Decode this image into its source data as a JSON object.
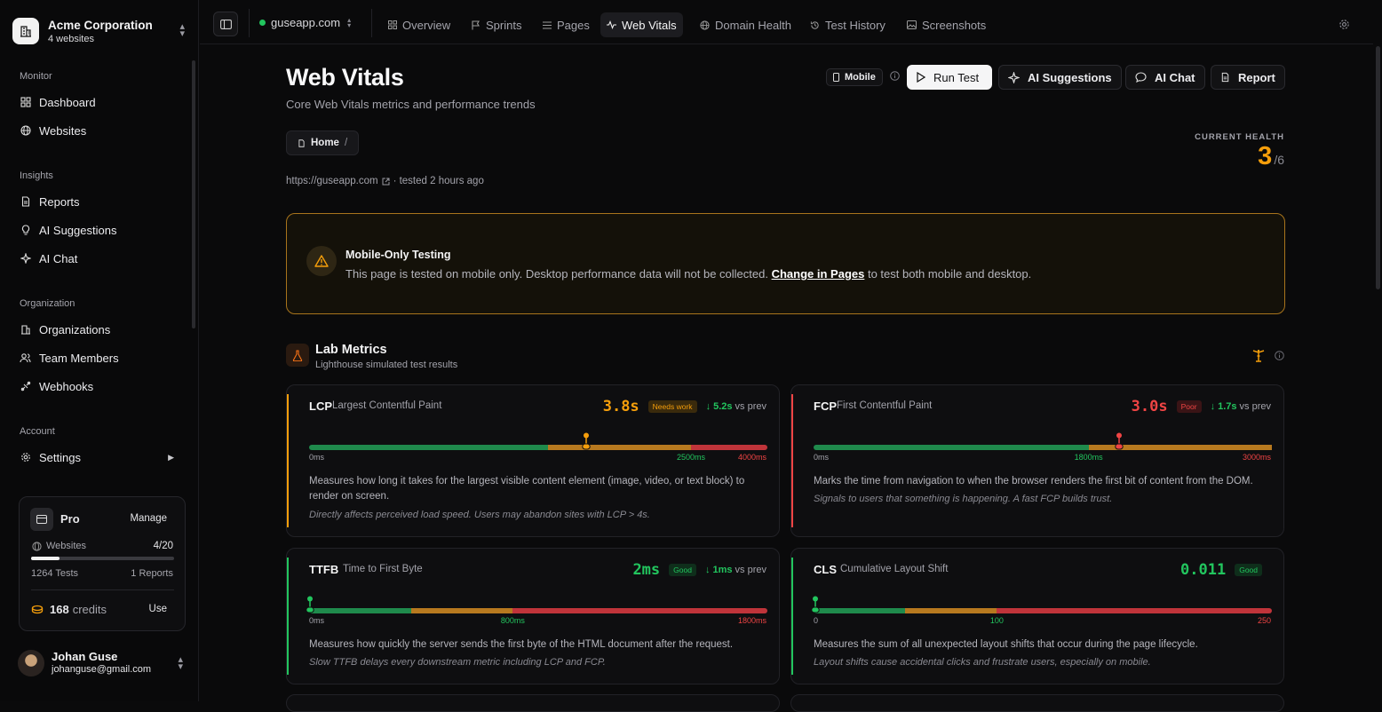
{
  "org": {
    "name": "Acme Corporation",
    "sub": "4 websites"
  },
  "sidebar": {
    "sections": [
      {
        "label": "Monitor",
        "items": [
          {
            "label": "Dashboard",
            "icon": "dashboard-icon"
          },
          {
            "label": "Websites",
            "icon": "globe-icon"
          }
        ]
      },
      {
        "label": "Insights",
        "items": [
          {
            "label": "Reports",
            "icon": "file-icon"
          },
          {
            "label": "AI Suggestions",
            "icon": "lightbulb-icon"
          },
          {
            "label": "AI Chat",
            "icon": "sparkle-icon"
          }
        ]
      },
      {
        "label": "Organization",
        "items": [
          {
            "label": "Organizations",
            "icon": "building-icon"
          },
          {
            "label": "Team Members",
            "icon": "users-icon"
          },
          {
            "label": "Webhooks",
            "icon": "webhook-icon"
          }
        ]
      },
      {
        "label": "Account",
        "items": [
          {
            "label": "Settings",
            "icon": "gear-icon"
          }
        ]
      }
    ]
  },
  "plan": {
    "name": "Pro",
    "manage": "Manage",
    "websites_label": "Websites",
    "websites_value": "4/20",
    "websites_fraction": 0.2,
    "tests": "1264 Tests",
    "reports": "1 Reports",
    "credits": "168",
    "credits_label": "credits",
    "use": "Use"
  },
  "user": {
    "name": "Johan Guse",
    "email": "johanguse@gmail.com"
  },
  "topbar": {
    "site": "guseapp.com",
    "tabs": [
      {
        "label": "Overview",
        "icon": "grid-icon",
        "active": false
      },
      {
        "label": "Sprints",
        "icon": "flag-icon",
        "active": false
      },
      {
        "label": "Pages",
        "icon": "list-icon",
        "active": false
      },
      {
        "label": "Web Vitals",
        "icon": "pulse-icon",
        "active": true
      },
      {
        "label": "Domain Health",
        "icon": "globe-icon",
        "active": false
      },
      {
        "label": "Test History",
        "icon": "history-icon",
        "active": false
      },
      {
        "label": "Screenshots",
        "icon": "image-icon",
        "active": false
      }
    ]
  },
  "header": {
    "title": "Web Vitals",
    "subtitle": "Core Web Vitals metrics and performance trends",
    "breadcrumb": "Home",
    "breadcrumb_sep": "/",
    "url": "https://guseapp.com",
    "tested": "· tested 2 hours ago"
  },
  "actions": {
    "device": "Mobile",
    "run": "Run Test",
    "suggestions": "AI Suggestions",
    "chat": "AI Chat",
    "report": "Report"
  },
  "health": {
    "label": "CURRENT HEALTH",
    "value": "3",
    "total": "/6"
  },
  "alert": {
    "title": "Mobile-Only Testing",
    "body_before": "This page is tested on mobile only. Desktop performance data will not be collected.",
    "link": "Change in Pages",
    "body_after": "to test both mobile and desktop."
  },
  "lab": {
    "title": "Lab Metrics",
    "subtitle": "Lighthouse simulated test results"
  },
  "colors": {
    "good": "#22c55e",
    "needs": "#f59e0b",
    "poor": "#ef4444"
  },
  "metrics": [
    {
      "abbr": "LCP",
      "name": "Largest Contentful Paint",
      "value": "3.8s",
      "status": "Needs work",
      "status_level": "needs",
      "delta": "↓ 5.2s",
      "vs": "vs prev",
      "ticks": [
        "0ms",
        "2500ms",
        "4000ms"
      ],
      "max": 4800,
      "good": 2500,
      "needs": 4000,
      "position": 2900,
      "desc": "Measures how long it takes for the largest visible content element (image, video, or text block) to render on screen.",
      "note": "Directly affects perceived load speed. Users may abandon sites with LCP > 4s."
    },
    {
      "abbr": "FCP",
      "name": "First Contentful Paint",
      "value": "3.0s",
      "status": "Poor",
      "status_level": "poor",
      "delta": "↓ 1.7s",
      "vs": "vs prev",
      "ticks": [
        "0ms",
        "1800ms",
        "3000ms"
      ],
      "max": 3000,
      "good": 1800,
      "needs": 3000,
      "position": 2000,
      "desc": "Marks the time from navigation to when the browser renders the first bit of content from the DOM.",
      "note": "Signals to users that something is happening. A fast FCP builds trust."
    },
    {
      "abbr": "TTFB",
      "name": "Time to First Byte",
      "value": "2ms",
      "status": "Good",
      "status_level": "good",
      "delta": "↓ 1ms",
      "vs": "vs prev",
      "ticks": [
        "0ms",
        "800ms",
        "1800ms"
      ],
      "max": 1800,
      "good": 400,
      "needs": 800,
      "position": 2,
      "desc": "Measures how quickly the server sends the first byte of the HTML document after the request.",
      "note": "Slow TTFB delays every downstream metric including LCP and FCP."
    },
    {
      "abbr": "CLS",
      "name": "Cumulative Layout Shift",
      "value": "0.011",
      "status": "Good",
      "status_level": "good",
      "delta": "",
      "vs": "",
      "ticks": [
        "0",
        "100",
        "250"
      ],
      "max": 250,
      "good": 50,
      "needs": 100,
      "position": 1.1,
      "desc": "Measures the sum of all unexpected layout shifts that occur during the page lifecycle.",
      "note": "Layout shifts cause accidental clicks and frustrate users, especially on mobile."
    }
  ]
}
